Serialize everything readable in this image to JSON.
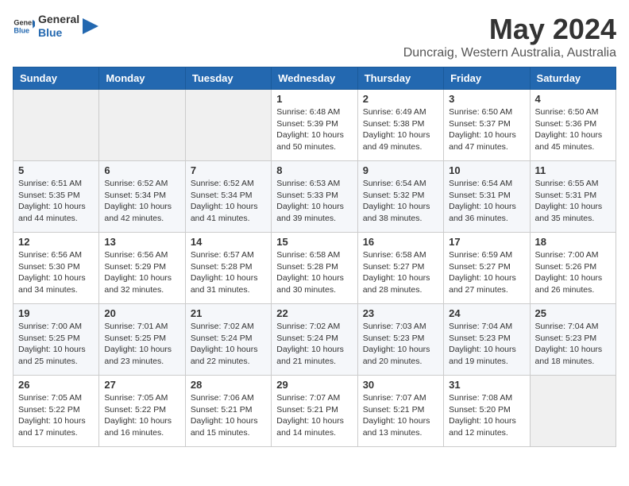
{
  "header": {
    "logo_line1": "General",
    "logo_line2": "Blue",
    "title": "May 2024",
    "subtitle": "Duncraig, Western Australia, Australia"
  },
  "columns": [
    "Sunday",
    "Monday",
    "Tuesday",
    "Wednesday",
    "Thursday",
    "Friday",
    "Saturday"
  ],
  "weeks": [
    [
      {
        "day": "",
        "info": ""
      },
      {
        "day": "",
        "info": ""
      },
      {
        "day": "",
        "info": ""
      },
      {
        "day": "1",
        "info": "Sunrise: 6:48 AM\nSunset: 5:39 PM\nDaylight: 10 hours\nand 50 minutes."
      },
      {
        "day": "2",
        "info": "Sunrise: 6:49 AM\nSunset: 5:38 PM\nDaylight: 10 hours\nand 49 minutes."
      },
      {
        "day": "3",
        "info": "Sunrise: 6:50 AM\nSunset: 5:37 PM\nDaylight: 10 hours\nand 47 minutes."
      },
      {
        "day": "4",
        "info": "Sunrise: 6:50 AM\nSunset: 5:36 PM\nDaylight: 10 hours\nand 45 minutes."
      }
    ],
    [
      {
        "day": "5",
        "info": "Sunrise: 6:51 AM\nSunset: 5:35 PM\nDaylight: 10 hours\nand 44 minutes."
      },
      {
        "day": "6",
        "info": "Sunrise: 6:52 AM\nSunset: 5:34 PM\nDaylight: 10 hours\nand 42 minutes."
      },
      {
        "day": "7",
        "info": "Sunrise: 6:52 AM\nSunset: 5:34 PM\nDaylight: 10 hours\nand 41 minutes."
      },
      {
        "day": "8",
        "info": "Sunrise: 6:53 AM\nSunset: 5:33 PM\nDaylight: 10 hours\nand 39 minutes."
      },
      {
        "day": "9",
        "info": "Sunrise: 6:54 AM\nSunset: 5:32 PM\nDaylight: 10 hours\nand 38 minutes."
      },
      {
        "day": "10",
        "info": "Sunrise: 6:54 AM\nSunset: 5:31 PM\nDaylight: 10 hours\nand 36 minutes."
      },
      {
        "day": "11",
        "info": "Sunrise: 6:55 AM\nSunset: 5:31 PM\nDaylight: 10 hours\nand 35 minutes."
      }
    ],
    [
      {
        "day": "12",
        "info": "Sunrise: 6:56 AM\nSunset: 5:30 PM\nDaylight: 10 hours\nand 34 minutes."
      },
      {
        "day": "13",
        "info": "Sunrise: 6:56 AM\nSunset: 5:29 PM\nDaylight: 10 hours\nand 32 minutes."
      },
      {
        "day": "14",
        "info": "Sunrise: 6:57 AM\nSunset: 5:28 PM\nDaylight: 10 hours\nand 31 minutes."
      },
      {
        "day": "15",
        "info": "Sunrise: 6:58 AM\nSunset: 5:28 PM\nDaylight: 10 hours\nand 30 minutes."
      },
      {
        "day": "16",
        "info": "Sunrise: 6:58 AM\nSunset: 5:27 PM\nDaylight: 10 hours\nand 28 minutes."
      },
      {
        "day": "17",
        "info": "Sunrise: 6:59 AM\nSunset: 5:27 PM\nDaylight: 10 hours\nand 27 minutes."
      },
      {
        "day": "18",
        "info": "Sunrise: 7:00 AM\nSunset: 5:26 PM\nDaylight: 10 hours\nand 26 minutes."
      }
    ],
    [
      {
        "day": "19",
        "info": "Sunrise: 7:00 AM\nSunset: 5:25 PM\nDaylight: 10 hours\nand 25 minutes."
      },
      {
        "day": "20",
        "info": "Sunrise: 7:01 AM\nSunset: 5:25 PM\nDaylight: 10 hours\nand 23 minutes."
      },
      {
        "day": "21",
        "info": "Sunrise: 7:02 AM\nSunset: 5:24 PM\nDaylight: 10 hours\nand 22 minutes."
      },
      {
        "day": "22",
        "info": "Sunrise: 7:02 AM\nSunset: 5:24 PM\nDaylight: 10 hours\nand 21 minutes."
      },
      {
        "day": "23",
        "info": "Sunrise: 7:03 AM\nSunset: 5:23 PM\nDaylight: 10 hours\nand 20 minutes."
      },
      {
        "day": "24",
        "info": "Sunrise: 7:04 AM\nSunset: 5:23 PM\nDaylight: 10 hours\nand 19 minutes."
      },
      {
        "day": "25",
        "info": "Sunrise: 7:04 AM\nSunset: 5:23 PM\nDaylight: 10 hours\nand 18 minutes."
      }
    ],
    [
      {
        "day": "26",
        "info": "Sunrise: 7:05 AM\nSunset: 5:22 PM\nDaylight: 10 hours\nand 17 minutes."
      },
      {
        "day": "27",
        "info": "Sunrise: 7:05 AM\nSunset: 5:22 PM\nDaylight: 10 hours\nand 16 minutes."
      },
      {
        "day": "28",
        "info": "Sunrise: 7:06 AM\nSunset: 5:21 PM\nDaylight: 10 hours\nand 15 minutes."
      },
      {
        "day": "29",
        "info": "Sunrise: 7:07 AM\nSunset: 5:21 PM\nDaylight: 10 hours\nand 14 minutes."
      },
      {
        "day": "30",
        "info": "Sunrise: 7:07 AM\nSunset: 5:21 PM\nDaylight: 10 hours\nand 13 minutes."
      },
      {
        "day": "31",
        "info": "Sunrise: 7:08 AM\nSunset: 5:20 PM\nDaylight: 10 hours\nand 12 minutes."
      },
      {
        "day": "",
        "info": ""
      }
    ]
  ]
}
